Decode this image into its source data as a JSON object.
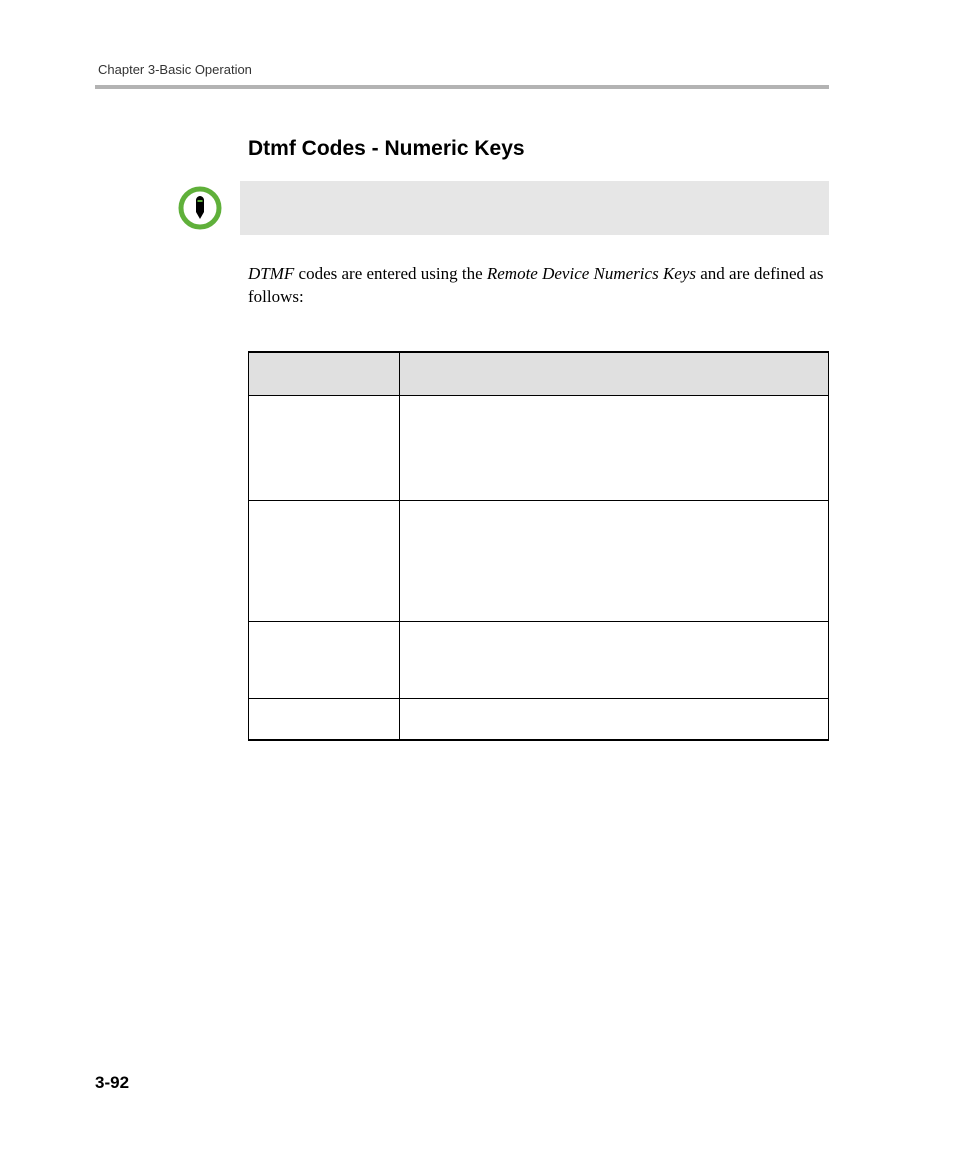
{
  "header": {
    "running_head": "Chapter 3-Basic Operation"
  },
  "main": {
    "heading": "Dtmf Codes - Numeric Keys",
    "note_icon_name": "note-pen-icon",
    "paragraph": {
      "pre": "DTMF",
      "mid1": " codes are entered using the ",
      "ital": "Remote Device Numerics Keys",
      "post": " and are defined as follows:"
    },
    "table": {
      "headers": [
        "",
        ""
      ],
      "rows": [
        [
          "",
          ""
        ],
        [
          "",
          ""
        ],
        [
          "",
          ""
        ],
        [
          "",
          ""
        ]
      ]
    }
  },
  "footer": {
    "page_number": "3-92"
  }
}
